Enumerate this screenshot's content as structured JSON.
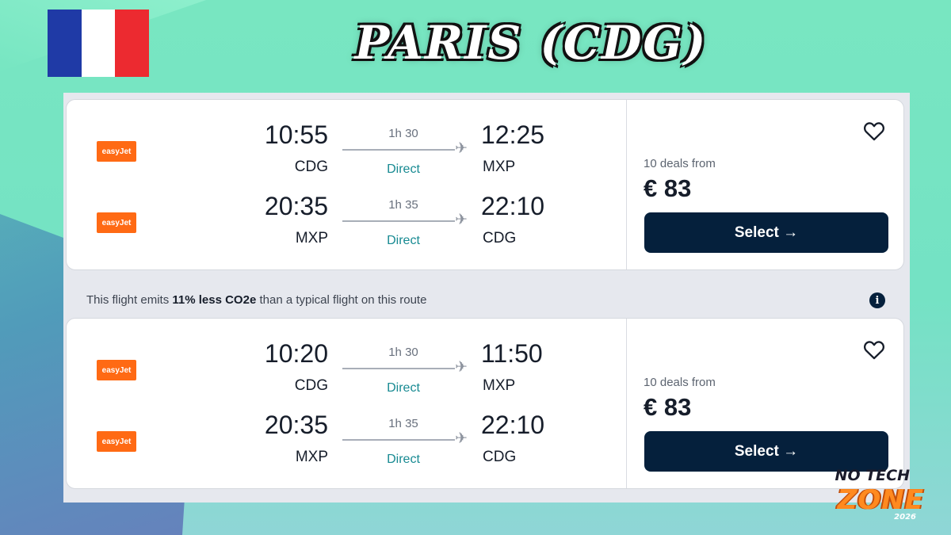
{
  "header": {
    "title": "PARIS (CDG)"
  },
  "colors": {
    "flag": [
      "#1f3aa6",
      "#ffffff",
      "#ec2a30"
    ],
    "accent_dark": "#05203c",
    "airline_orange": "#ff6a14",
    "direct_teal": "#178a92"
  },
  "results": [
    {
      "legs": [
        {
          "airline": "easyJet",
          "dep_time": "10:55",
          "dep_code": "CDG",
          "duration": "1h 30",
          "stops": "Direct",
          "arr_time": "12:25",
          "arr_code": "MXP"
        },
        {
          "airline": "easyJet",
          "dep_time": "20:35",
          "dep_code": "MXP",
          "duration": "1h 35",
          "stops": "Direct",
          "arr_time": "22:10",
          "arr_code": "CDG"
        }
      ],
      "deals": "10 deals from",
      "price": "€ 83",
      "select_label": "Select →"
    },
    {
      "legs": [
        {
          "airline": "easyJet",
          "dep_time": "10:20",
          "dep_code": "CDG",
          "duration": "1h 30",
          "stops": "Direct",
          "arr_time": "11:50",
          "arr_code": "MXP"
        },
        {
          "airline": "easyJet",
          "dep_time": "20:35",
          "dep_code": "MXP",
          "duration": "1h 35",
          "stops": "Direct",
          "arr_time": "22:10",
          "arr_code": "CDG"
        }
      ],
      "deals": "10 deals from",
      "price": "€ 83",
      "select_label": "Select →"
    }
  ],
  "eco_banner": {
    "prefix": "This flight emits ",
    "highlight": "11% less CO2e",
    "suffix": " than a typical flight on this route",
    "icon": "i"
  },
  "badge": {
    "line1": "NO TECH",
    "line2": "ZONE",
    "year": "2026"
  },
  "icons": {
    "favorite": "heart-icon",
    "info": "info-icon",
    "plane": "plane-icon",
    "flag": "france-flag"
  }
}
